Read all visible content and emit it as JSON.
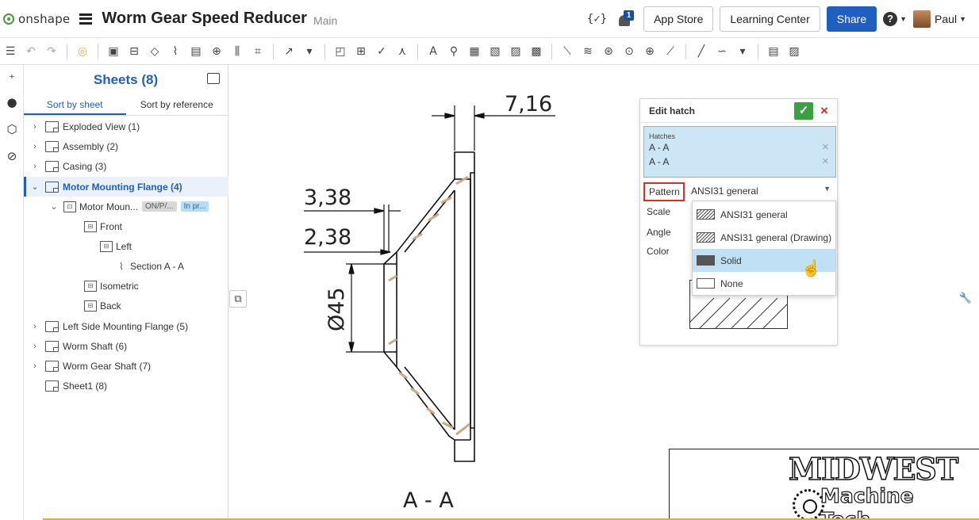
{
  "app": {
    "brand": "onshape",
    "document_title": "Worm Gear Speed Reducer",
    "branch": "Main",
    "curly_icon": "{✓}",
    "notification_count": "1",
    "app_store": "App Store",
    "learning_center": "Learning Center",
    "share": "Share",
    "help": "?",
    "user": "Paul"
  },
  "panel": {
    "title": "Sheets (8)",
    "tabs": [
      "Sort by sheet",
      "Sort by reference"
    ],
    "rows": [
      {
        "label": "Exploded View (1)"
      },
      {
        "label": "Assembly (2)"
      },
      {
        "label": "Casing (3)"
      },
      {
        "label": "Motor Mounting Flange (4)"
      },
      {
        "label": "Motor Moun...",
        "pill1": "ON/P/...",
        "pill2": "In pr..."
      },
      {
        "label": "Front"
      },
      {
        "label": "Left"
      },
      {
        "label": "Section A - A"
      },
      {
        "label": "Isometric"
      },
      {
        "label": "Back"
      },
      {
        "label": "Left Side Mounting Flange (5)"
      },
      {
        "label": "Worm Shaft (6)"
      },
      {
        "label": "Worm Gear Shaft (7)"
      },
      {
        "label": "Sheet1 (8)"
      }
    ]
  },
  "drawing": {
    "dim_top": "7,16",
    "dim_a": "3,38",
    "dim_b": "2,38",
    "dim_dia": "Ø45",
    "section_label": "A - A"
  },
  "dialog": {
    "title": "Edit hatch",
    "ok": "✓",
    "cancel": "×",
    "hatches_caption": "Hatches",
    "hatches": [
      "A - A",
      "A - A"
    ],
    "pattern_label": "Pattern",
    "pattern_value": "ANSI31 general",
    "scale_label": "Scale",
    "angle_label": "Angle",
    "color_label": "Color"
  },
  "dropdown": {
    "options": [
      "ANSI31 general",
      "ANSI31 general (Drawing)",
      "Solid",
      "None"
    ],
    "highlighted": "Solid"
  },
  "title_block": {
    "company": "MIDWEST",
    "line2": "Machine",
    "line3": "Tech"
  },
  "colors": {
    "accent": "#1f5fbf",
    "confirm": "#3aa043",
    "cancel": "#d0312d",
    "hatch_brown": "#c8a98a",
    "highlight": "#bfe0f5"
  }
}
